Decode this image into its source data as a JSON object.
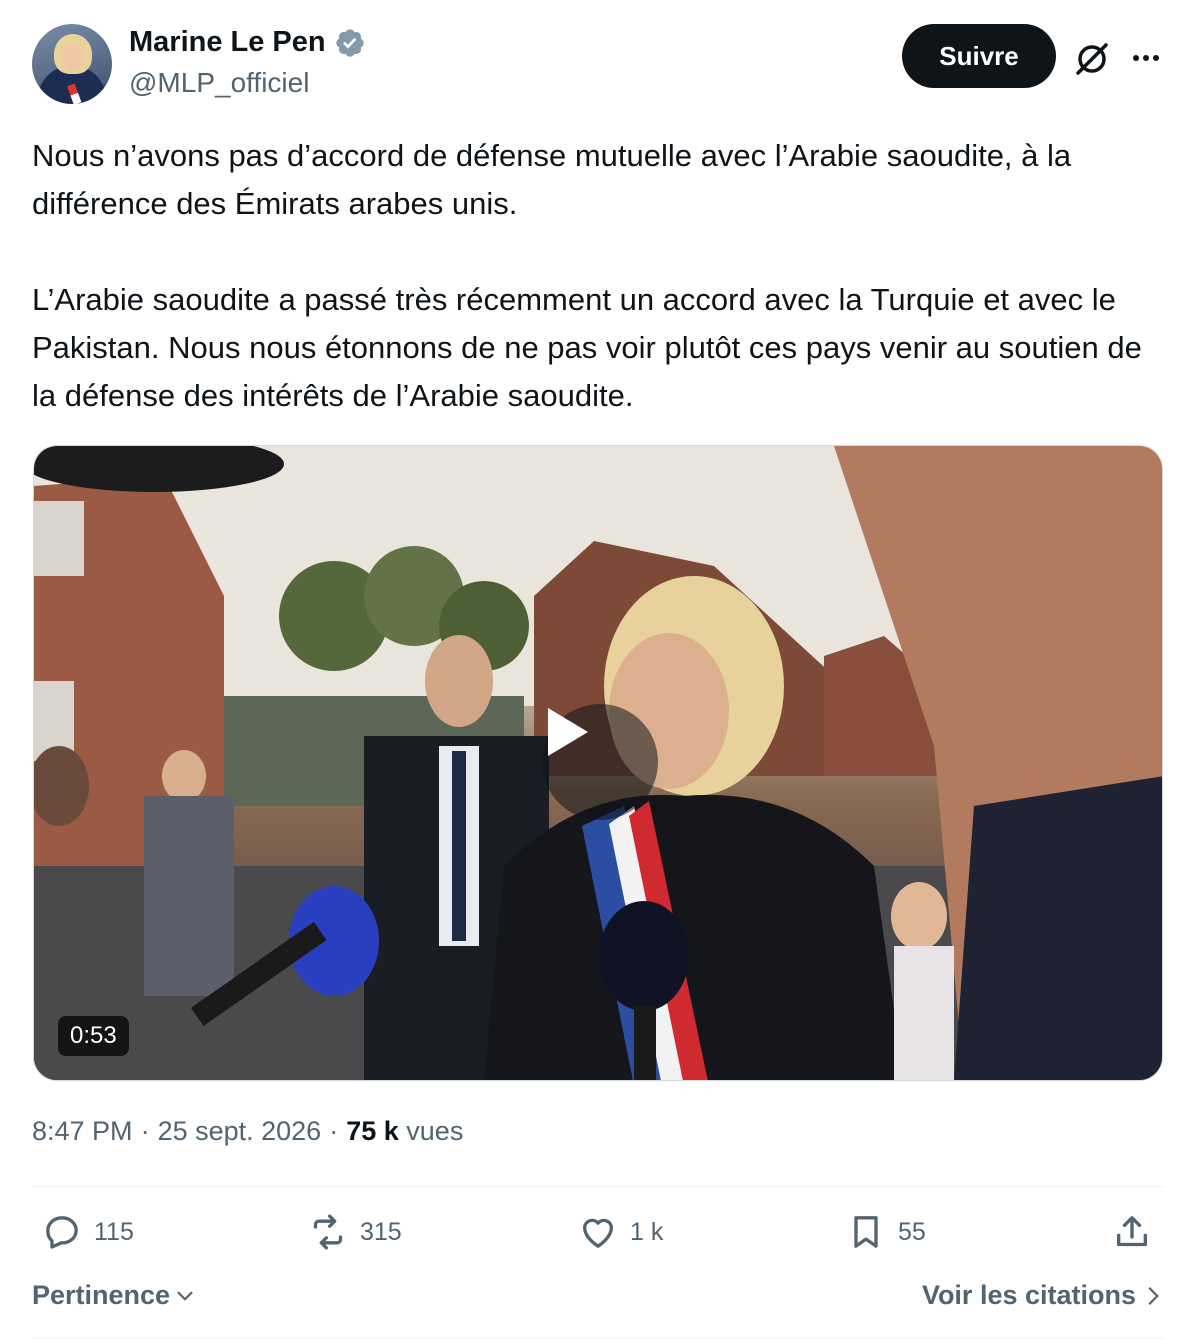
{
  "author": {
    "name": "Marine Le Pen",
    "handle": "@MLP_officiel",
    "verified": true
  },
  "header": {
    "follow_label": "Suivre",
    "icons": [
      "grok-icon",
      "more-icon"
    ]
  },
  "tweet": {
    "paragraphs": [
      "Nous n’avons pas d’accord de défense mutuelle avec l’Arabie saoudite, à la différence des Émirats arabes unis.",
      "L’Arabie saoudite a passé très récemment un accord avec la Turquie et avec le Pakistan. Nous nous étonnons de ne pas voir plutôt ces pays venir au soutien de la défense des intérêts de l’Arabie saoudite."
    ],
    "media": {
      "type": "video",
      "duration": "0:53"
    },
    "time": "8:47 PM",
    "date": "25 sept. 2026",
    "views_count": "75 k",
    "views_label": "vues",
    "separator": "·"
  },
  "actions": {
    "replies": "115",
    "reposts": "315",
    "likes": "1 k",
    "bookmarks": "55"
  },
  "footer": {
    "sort_label": "Pertinence",
    "quotes_label": "Voir les citations"
  },
  "colors": {
    "text": "#0f1419",
    "secondary": "#536471",
    "verified": "#829aab",
    "button": "#0f1419"
  }
}
